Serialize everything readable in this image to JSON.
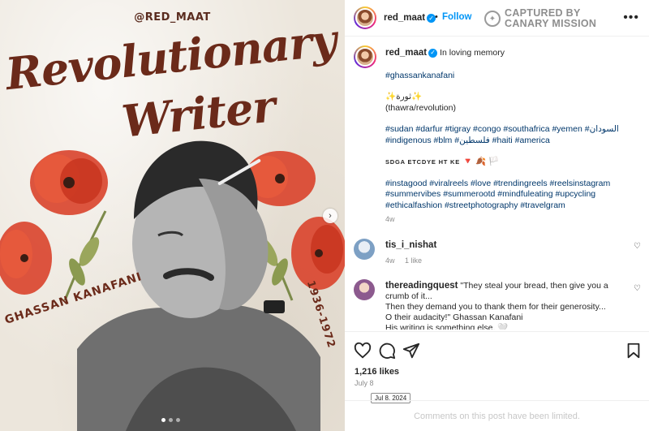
{
  "poster": {
    "handle": "@RED_MAAT",
    "title_line1": "Revolutionary",
    "title_line2": "Writer",
    "name": "GHASSAN KANAFANI",
    "years": "1936-1972",
    "carousel_next_icon": "chevron-right-icon",
    "carousel_pages": 3,
    "carousel_active": 1
  },
  "header": {
    "username": "red_maat",
    "separator": "•",
    "follow_label": "Follow",
    "watermark_line1": "CAPTURED BY",
    "watermark_line2": "CANARY MISSION",
    "more_icon": "more-options-icon"
  },
  "caption": {
    "username": "red_maat",
    "text": "In loving memory",
    "hashtag1": "#ghassankanafani",
    "arabic_line": "✨ثورة✨",
    "translation": "(thawra/revolution)",
    "tags_line1": "#sudan #darfur #tigray #congo #southafrica #yemen #السودان",
    "tags_line2": "#indigenous #blm #فلسطين #haiti #america",
    "small_caps": "SDGA ETCDYE HT KE",
    "small_caps_emojis": "🔻 🍂 🏳️",
    "tags_block1": "#instagood #viralreels #love #trendingreels #reelsinstagram",
    "tags_block2": "#summervibes #summerootd #mindfuleating #upcycling",
    "tags_block3": "#ethicalfashion #streetphotography #travelgram",
    "age": "4w"
  },
  "comments": [
    {
      "username": "tis_i_nishat",
      "text": "",
      "age": "4w",
      "likes": "1 like"
    },
    {
      "username": "thereadingquest",
      "line1": "\"They steal your bread, then give you a",
      "line2": "crumb of it...",
      "line3": "Then they demand you to thank them for their generosity...",
      "line4": "O their audacity!\" Ghassan Kanafani",
      "line5": "His writing is something else. 🤍"
    }
  ],
  "actions": {
    "like_icon": "heart-icon",
    "comment_icon": "comment-icon",
    "share_icon": "share-icon",
    "save_icon": "bookmark-icon"
  },
  "likes": "1,216 likes",
  "date": "July 8",
  "date_tooltip": "Jul 8, 2024",
  "comments_limited": "Comments on this post have been limited.",
  "colors": {
    "accent": "#0095f6",
    "hashtag": "#00376b",
    "poster_ink": "#6b2a1a",
    "poppy": "#d9432b"
  }
}
